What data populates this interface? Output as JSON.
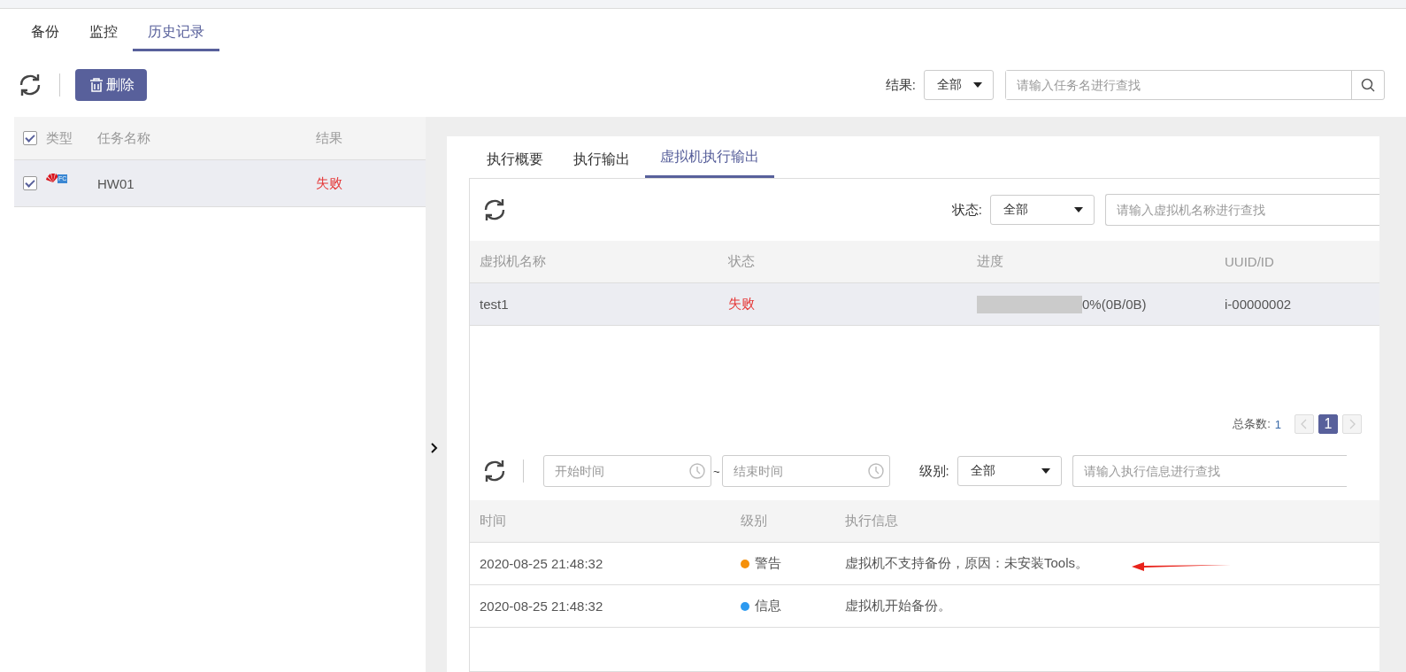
{
  "tabs": [
    {
      "label": "备份",
      "selected": false
    },
    {
      "label": "监控",
      "selected": false
    },
    {
      "label": "历史记录",
      "selected": true
    }
  ],
  "toolbar": {
    "delete_button": "删除"
  },
  "filter": {
    "label": "结果:",
    "select": "全部",
    "search_placeholder": "请输入任务名进行查找"
  },
  "task_table": {
    "header_checked": true,
    "columns": [
      "类型",
      "任务名称",
      "结果"
    ],
    "rows": [
      {
        "checked": true,
        "selected": true,
        "type_badge": "FC",
        "name": "HW01",
        "result": "失败"
      }
    ]
  },
  "detail": {
    "tabs": [
      {
        "label": "执行概要",
        "selected": false
      },
      {
        "label": "执行输出",
        "selected": false
      },
      {
        "label": "虚拟机执行输出",
        "selected": true
      }
    ],
    "vm_filter": {
      "label": "状态:",
      "select": "全部",
      "search_placeholder": "请输入虚拟机名称进行查找"
    },
    "vm_table": {
      "columns": [
        "虚拟机名称",
        "状态",
        "进度",
        "UUID/ID"
      ],
      "rows": [
        {
          "name": "test1",
          "status": "失败",
          "level": 0,
          "progress": "0%(0B/0B)",
          "uuid": "i-00000002"
        }
      ]
    },
    "pagination": {
      "total_label": "总条数:",
      "total": "1",
      "pages": [
        {
          "label": "1",
          "selected": true
        }
      ]
    },
    "log_filter": {
      "start_placeholder": "开始时间",
      "separator": "~",
      "end_placeholder": "结束时间",
      "label": "级别:",
      "select": "全部",
      "search_placeholder": "请输入执行信息进行查找"
    },
    "log_table": {
      "columns": [
        "时间",
        "级别",
        "执行信息"
      ],
      "rows": [
        {
          "time": "2020-08-25 21:48:32",
          "level_label": "警告",
          "color": "#f5900a",
          "message": "虚拟机不支持备份，原因：未安装Tools。"
        },
        {
          "time": "2020-08-25 21:48:32",
          "level_label": "信息",
          "color": "#2d9af0",
          "message": "虚拟机开始备份。"
        }
      ]
    }
  }
}
